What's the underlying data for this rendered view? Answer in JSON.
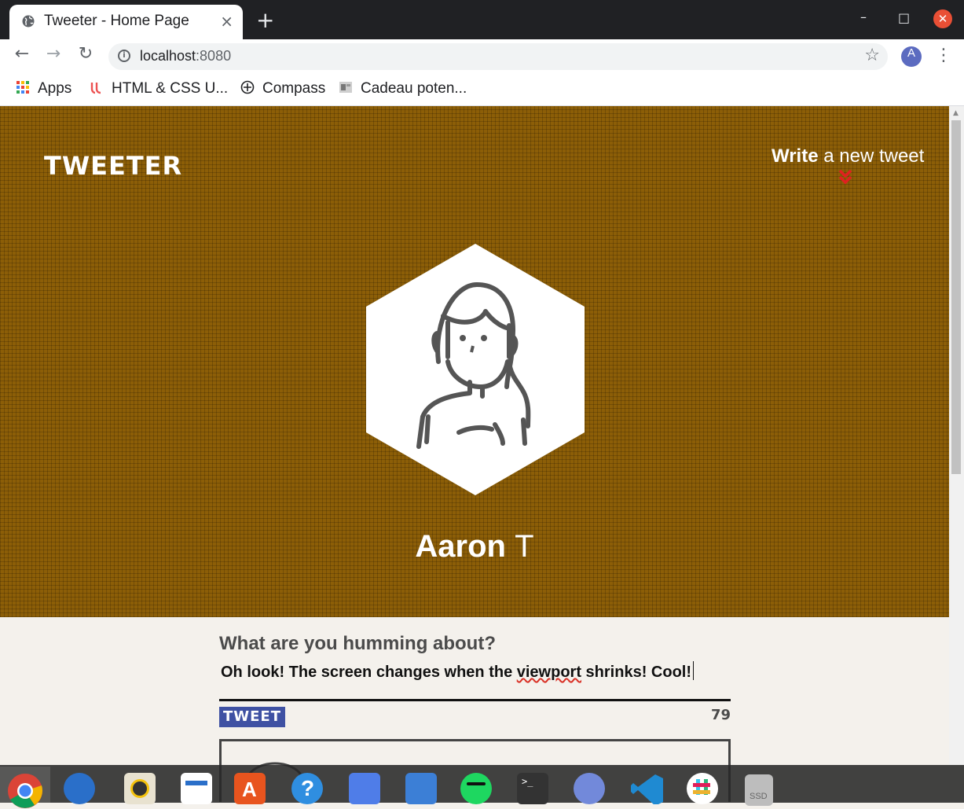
{
  "browser": {
    "tab_title": "Tweeter - Home Page",
    "tab_close": "×",
    "new_tab": "+",
    "url_host": "localhost",
    "url_port": ":8080",
    "profile_initial": "A",
    "bookmarks": [
      "Apps",
      "HTML & CSS U...",
      "Compass",
      "Cadeau poten..."
    ]
  },
  "header": {
    "brand": "TWEETER",
    "compose_bold": "Write",
    "compose_rest": " a new tweet"
  },
  "profile": {
    "name": "Aaron",
    "handle_char": "T"
  },
  "form": {
    "prompt": "What are you humming about?",
    "text_before": "Oh look! The screen changes when the ",
    "text_misspelled": "viewport",
    "text_after": " shrinks! Cool!",
    "submit_label": "TWEET",
    "char_count": "79"
  },
  "colors": {
    "hero_bg": "#8c5e07",
    "tweet_button": "#3f51a3",
    "chevron": "#e02020",
    "page_bg": "#f4f1ec"
  },
  "taskbar_apps": [
    "chrome",
    "thunderbird",
    "rhythmbox",
    "libreoffice-writer",
    "software-center",
    "help",
    "tasks",
    "files",
    "spotify",
    "terminal",
    "discord",
    "vscode",
    "slack",
    "ssd-drive"
  ]
}
